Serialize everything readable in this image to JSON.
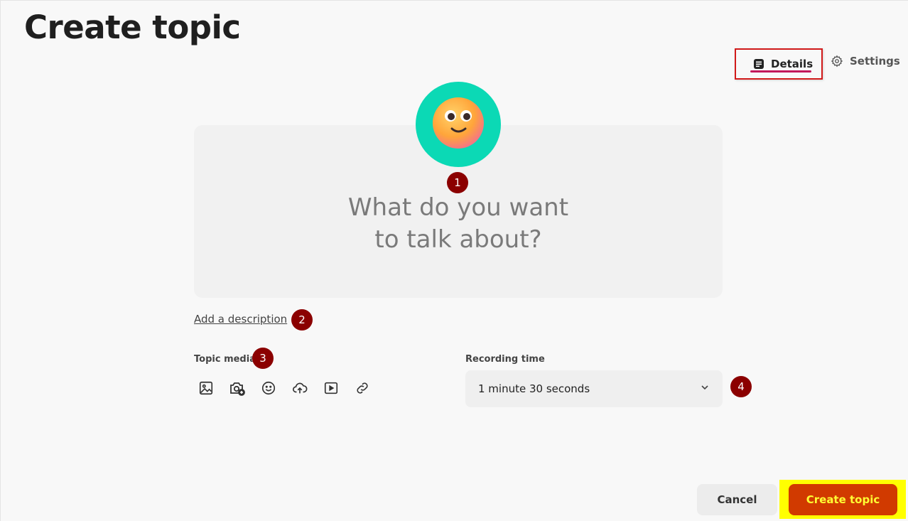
{
  "page": {
    "title": "Create topic"
  },
  "tabs": {
    "details": {
      "label": "Details",
      "icon": "details-icon"
    },
    "settings": {
      "label": "Settings",
      "icon": "gear-icon"
    }
  },
  "topic": {
    "prompt": "What do you want\nto talk about?",
    "avatar_icon": "smiling-face-emoji",
    "avatar_bg": "#0bd9b5"
  },
  "description": {
    "link_label": "Add a description"
  },
  "media": {
    "label": "Topic media",
    "icons": [
      "image-icon",
      "camera-add-icon",
      "emoji-icon",
      "upload-icon",
      "video-icon",
      "link-icon"
    ]
  },
  "recording": {
    "label": "Recording time",
    "selected": "1 minute 30 seconds"
  },
  "badges": [
    "1",
    "2",
    "3",
    "4"
  ],
  "actions": {
    "cancel_label": "Cancel",
    "create_label": "Create topic"
  },
  "colors": {
    "accent": "#d13a00",
    "tab_underline": "#c2185b",
    "highlight": "#ffff00",
    "badge": "#8b0000"
  }
}
